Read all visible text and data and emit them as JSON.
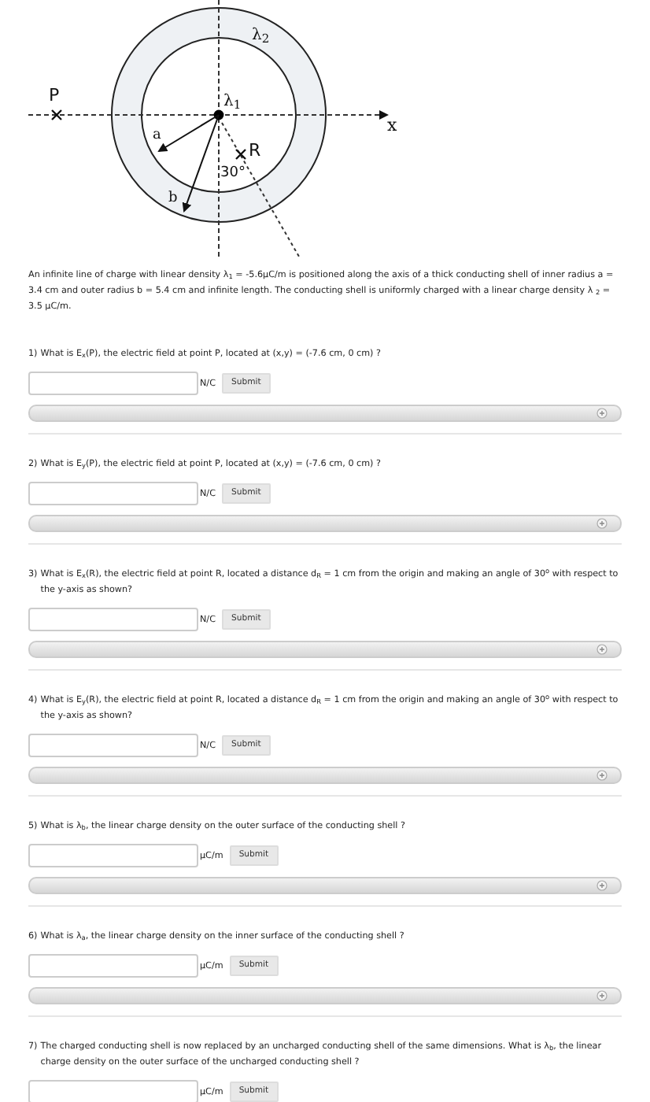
{
  "diagram": {
    "labels": [
      {
        "kind": "point",
        "text": "P"
      },
      {
        "kind": "axis",
        "text": "x"
      },
      {
        "kind": "outer-density",
        "text": "λ$_{2}$"
      },
      {
        "kind": "inner-density",
        "text": "λ$_{1}$"
      },
      {
        "kind": "inner-radius",
        "text": "a"
      },
      {
        "kind": "outer-radius",
        "text": "b"
      },
      {
        "kind": "point-r",
        "text": "R"
      },
      {
        "kind": "angle",
        "text": "30°"
      }
    ]
  },
  "description": "An infinite line of charge with linear density λ$_{1}$ = -5.6μC/m is positioned along the axis of a thick conducting shell of inner radius a = 3.4 cm and outer radius b = 5.4 cm and infinite length. The conducting shell is uniformly charged with a linear charge density λ $_{2}$ = 3.5 μC/m.",
  "questions": [
    {
      "number": "1)",
      "text": "What is E$_{x}$(P), the electric field at point P, located at (x,y) = (-7.6 cm, 0 cm) ?",
      "unit": "N/C",
      "button": "Submit",
      "hint_bar": true
    },
    {
      "number": "2)",
      "text": "What is E$_{y}$(P), the electric field at point P, located at (x,y) = (-7.6 cm, 0 cm) ?",
      "unit": "N/C",
      "button": "Submit",
      "hint_bar": true
    },
    {
      "number": "3)",
      "text": "What is E$_{x}$(R), the electric field at point R, located a distance d$_{R}$ = 1 cm from the origin and making an angle of 30$^{o}$ with respect to the y-axis as shown?",
      "unit": "N/C",
      "button": "Submit",
      "hint_bar": true
    },
    {
      "number": "4)",
      "text": "What is E$_{y}$(R), the electric field at point R, located a distance d$_{R}$ = 1 cm from the origin and making an angle of 30$^{o}$ with respect to the y-axis as shown?",
      "unit": "N/C",
      "button": "Submit",
      "hint_bar": true
    },
    {
      "number": "5)",
      "text": "What is λ$_{b}$, the linear charge density on the outer surface of the conducting shell ?",
      "unit": "μC/m",
      "button": "Submit",
      "hint_bar": true
    },
    {
      "number": "6)",
      "text": "What is λ$_{a}$, the linear charge density on the inner surface of the conducting shell ?",
      "unit": "μC/m",
      "button": "Submit",
      "hint_bar": true
    },
    {
      "number": "7)",
      "text": "The charged conducting shell is now replaced by an uncharged conducting shell of the same dimensions. What is λ$_{b}$, the linear charge density on the outer surface of the uncharged conducting shell ?",
      "unit": "μC/m",
      "button": "Submit"
    }
  ]
}
